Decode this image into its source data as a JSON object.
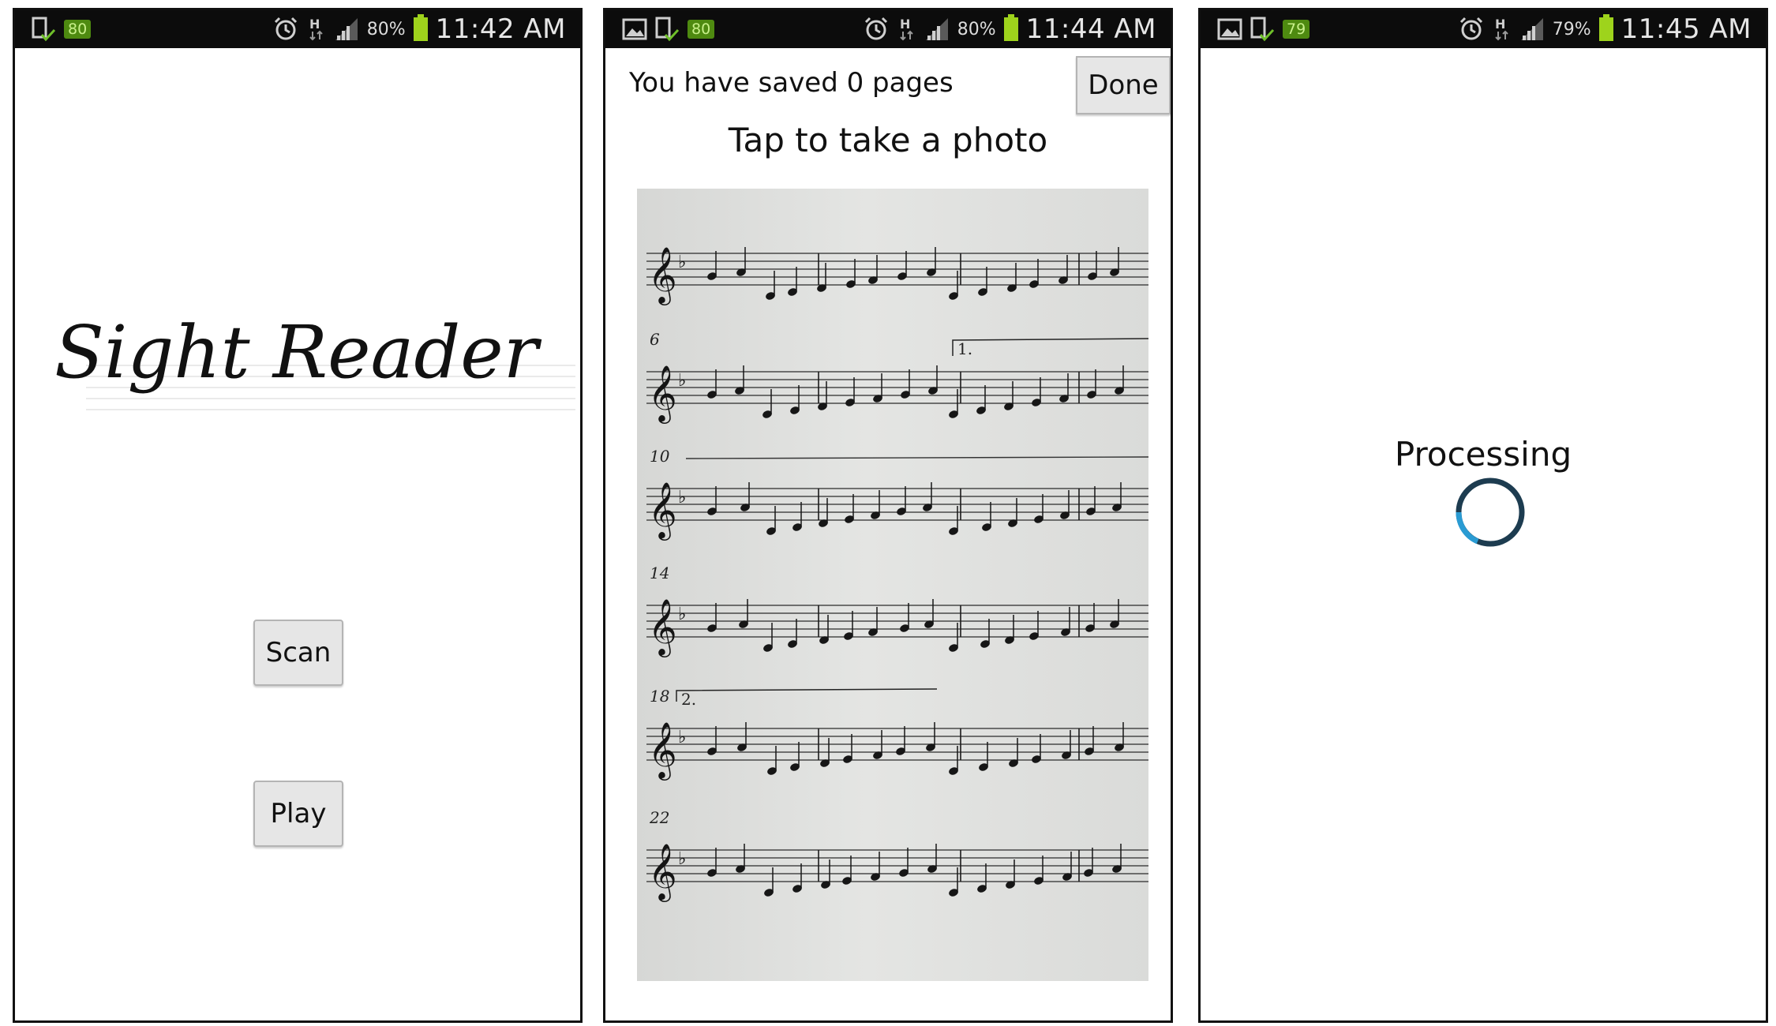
{
  "screens": [
    {
      "status": {
        "badge": "80",
        "battery_pct": "80%",
        "time": "11:42 AM"
      },
      "app_logo": "Sight Reader",
      "buttons": {
        "scan": "Scan",
        "play": "Play"
      }
    },
    {
      "status": {
        "badge": "80",
        "battery_pct": "80%",
        "time": "11:44 AM"
      },
      "saved_text": "You have saved 0 pages",
      "done_label": "Done",
      "instruction": "Tap to take a photo",
      "measure_numbers": [
        "6",
        "10",
        "14",
        "18",
        "22"
      ],
      "endings": [
        "1.",
        "2."
      ]
    },
    {
      "status": {
        "badge": "79",
        "battery_pct": "79%",
        "time": "11:45 AM"
      },
      "processing_text": "Processing"
    }
  ],
  "colors": {
    "status_bar": "#0c0c0c",
    "badge_green": "#4e8a10",
    "battery_green": "#9ed31c",
    "button_bg": "#e6e6e6",
    "spinner_ring": "#1d3c50",
    "spinner_accent": "#2a9bd3"
  },
  "icons": [
    "device-check-icon",
    "image-icon",
    "alarm-icon",
    "h-data-icon",
    "signal-icon",
    "battery-icon",
    "treble-clef-icon"
  ]
}
